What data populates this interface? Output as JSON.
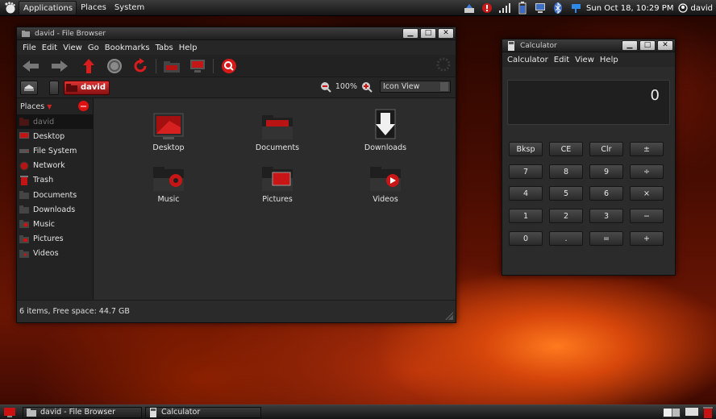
{
  "top_panel": {
    "menus": [
      "Applications",
      "Places",
      "System"
    ],
    "clock": "Sun Oct 18, 10:29 PM",
    "user": "david"
  },
  "file_browser": {
    "title": "david - File Browser",
    "menu": [
      "File",
      "Edit",
      "View",
      "Go",
      "Bookmarks",
      "Tabs",
      "Help"
    ],
    "location": "david",
    "zoom": "100%",
    "view_mode": "Icon View",
    "places_label": "Places",
    "places": [
      "david",
      "Desktop",
      "File System",
      "Network",
      "Trash",
      "Documents",
      "Downloads",
      "Music",
      "Pictures",
      "Videos"
    ],
    "files": [
      "Desktop",
      "Documents",
      "Downloads",
      "Music",
      "Pictures",
      "Videos"
    ],
    "status": "6 items, Free space: 44.7 GB"
  },
  "calculator": {
    "title": "Calculator",
    "menu": [
      "Calculator",
      "Edit",
      "View",
      "Help"
    ],
    "display": "0",
    "keys": [
      [
        "Bksp",
        "CE",
        "Clr",
        "±"
      ],
      [
        "7",
        "8",
        "9",
        "÷"
      ],
      [
        "4",
        "5",
        "6",
        "×"
      ],
      [
        "1",
        "2",
        "3",
        "−"
      ],
      [
        "0",
        ".",
        "=",
        "+"
      ]
    ]
  },
  "taskbar": {
    "items": [
      "david - File Browser",
      "Calculator"
    ]
  },
  "colors": {
    "accent": "#cc1a1a",
    "panel": "#1e1e1e",
    "window": "#2b2b2b"
  }
}
